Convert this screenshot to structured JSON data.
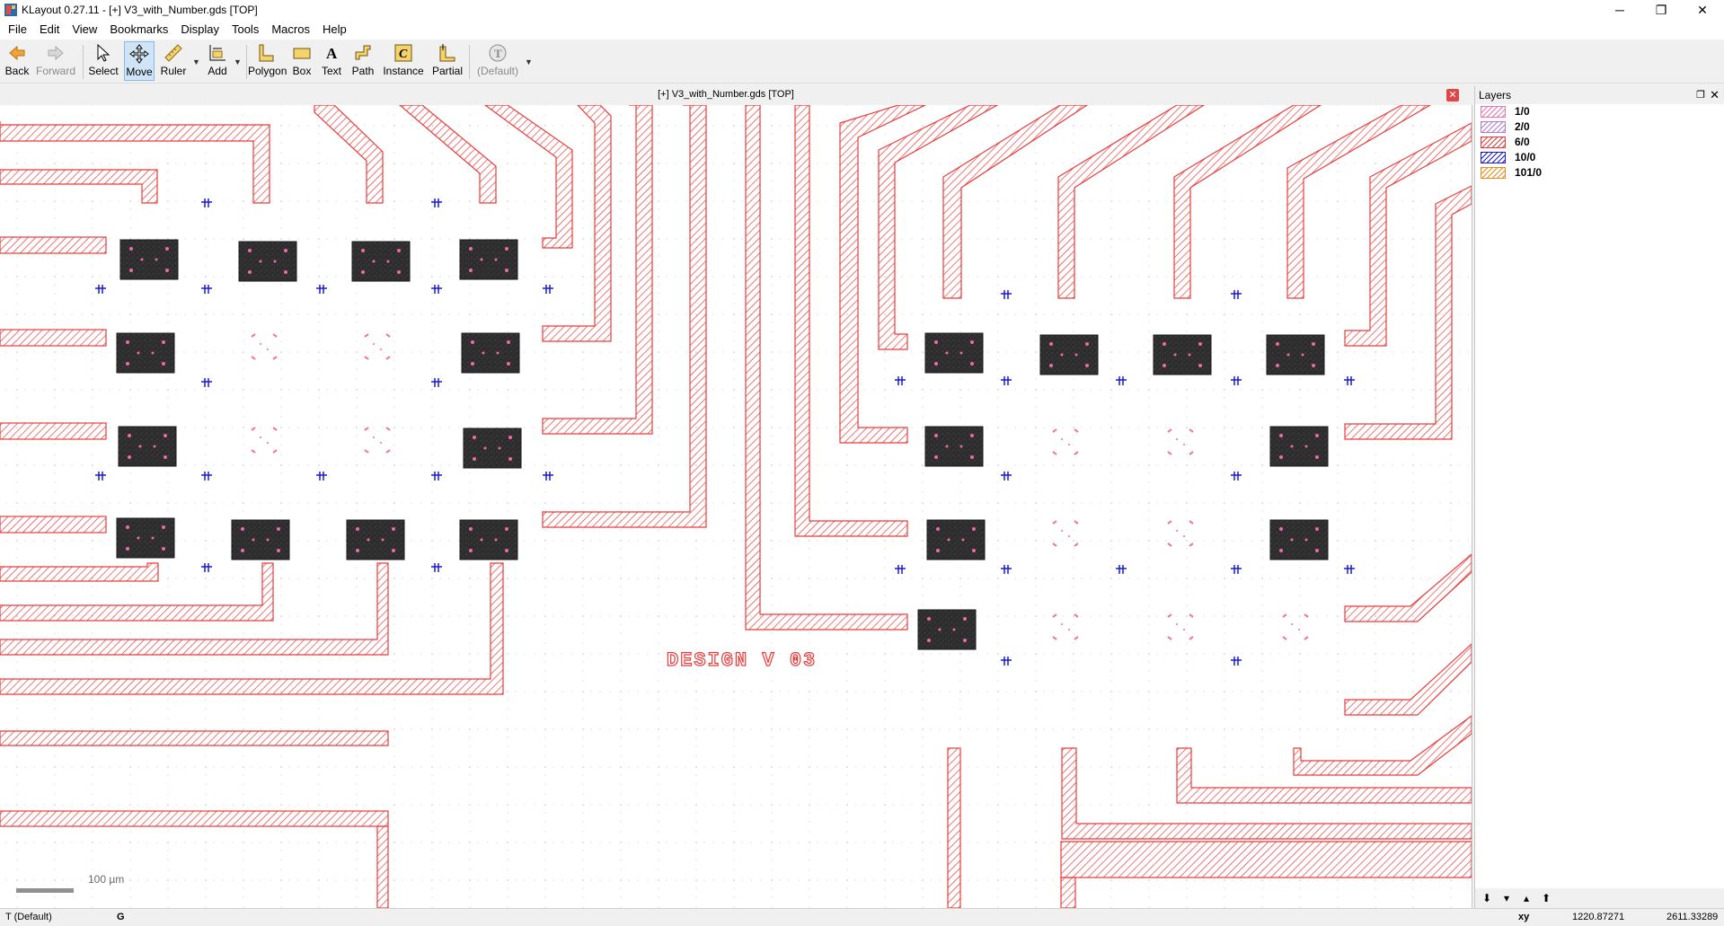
{
  "window": {
    "title": "KLayout 0.27.11 - [+] V3_with_Number.gds [TOP]",
    "minimize": "─",
    "maximize": "❐",
    "close": "✕"
  },
  "menu": [
    "File",
    "Edit",
    "View",
    "Bookmarks",
    "Display",
    "Tools",
    "Macros",
    "Help"
  ],
  "toolbar": {
    "back": "Back",
    "forward": "Forward",
    "select": "Select",
    "move": "Move",
    "ruler": "Ruler",
    "add": "Add",
    "polygon": "Polygon",
    "box": "Box",
    "text": "Text",
    "path": "Path",
    "instance": "Instance",
    "partial": "Partial",
    "default": "(Default)"
  },
  "layout_tab": {
    "title": "[+] V3_with_Number.gds [TOP]",
    "close": "✕"
  },
  "canvas": {
    "design_label": "DESIGN V 03",
    "scale_label": "100 µm"
  },
  "layers_panel": {
    "title": "Layers",
    "layers": [
      {
        "name": "1/0",
        "color": "#e878b4",
        "pattern": "diagonal"
      },
      {
        "name": "2/0",
        "color": "#b07cdc",
        "pattern": "diagonal"
      },
      {
        "name": "6/0",
        "color": "#e83c3c",
        "pattern": "diagonal"
      },
      {
        "name": "10/0",
        "color": "#1a1ad4",
        "pattern": "diagonal"
      },
      {
        "name": "101/0",
        "color": "#f08a1c",
        "pattern": "diagonal"
      }
    ],
    "ops": [
      "⬇",
      "▾",
      "▴",
      "⬆"
    ]
  },
  "statusbar": {
    "mode": "T  (Default)",
    "grid": "G",
    "coord_label": "xy",
    "x": "1220.87271",
    "y": "2611.33289"
  }
}
